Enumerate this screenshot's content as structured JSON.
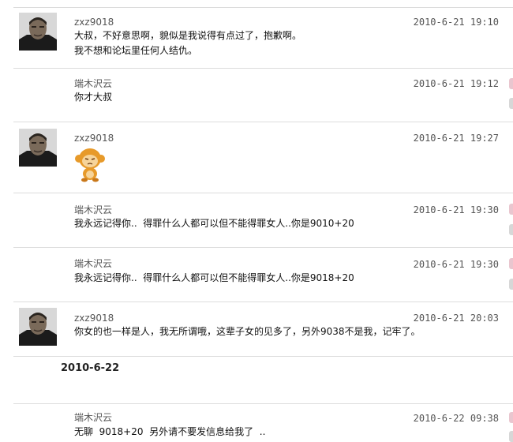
{
  "posts": [
    {
      "user": "zxz9018",
      "time": "2010-6-21 19:10",
      "lines": [
        "大叔，不好意思啊，貌似是我说得有点过了，抱歉啊。",
        "我不想和论坛里任何人结仇。"
      ]
    },
    {
      "user": "端木沢云",
      "time": "2010-6-21 19:12",
      "lines": [
        "你才大叔"
      ]
    },
    {
      "user": "zxz9018",
      "time": "2010-6-21 19:27",
      "lines": []
    },
    {
      "user": "端木沢云",
      "time": "2010-6-21 19:30",
      "lines": [
        "我永远记得你..  得罪什么人都可以但不能得罪女人..你是9010+20"
      ]
    },
    {
      "user": "端木沢云",
      "time": "2010-6-21 19:30",
      "lines": [
        "我永远记得你..  得罪什么人都可以但不能得罪女人..你是9018+20"
      ]
    },
    {
      "user": "zxz9018",
      "time": "2010-6-21 20:03",
      "lines": [
        "你女的也一样是人，我无所谓哦，这辈子女的见多了，另外9038不是我，记牢了。"
      ]
    },
    {
      "user": "端木沢云",
      "time": "2010-6-22 09:38",
      "lines": [
        "无聊  9018+20  另外请不要发信息给我了  .."
      ]
    }
  ],
  "date_heading": "2010-6-22",
  "colors": {
    "separator": "#dcdcdc",
    "meta_text": "#555555",
    "body_text": "#111111",
    "edge_pink": "#e9c6cf",
    "edge_gray": "#d7d7d7"
  },
  "icons": {
    "avatar": "man-portrait-avatar",
    "emoticon": "monkey-emoticon"
  }
}
